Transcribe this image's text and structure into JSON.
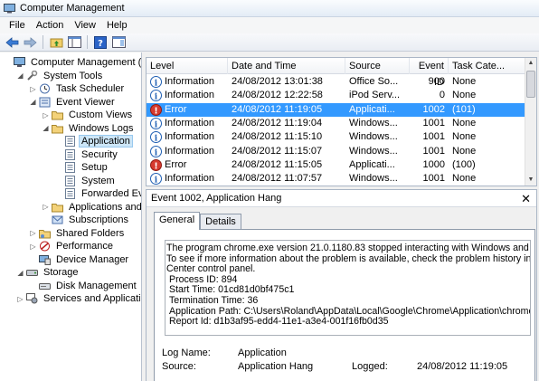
{
  "window": {
    "title": "Computer Management"
  },
  "menu": [
    "File",
    "Action",
    "View",
    "Help"
  ],
  "tree": [
    {
      "label": "Computer Management (Local",
      "indent": 0,
      "arrow": "",
      "icon": "computer-icon"
    },
    {
      "label": "System Tools",
      "indent": 1,
      "arrow": "◢",
      "icon": "tools-icon"
    },
    {
      "label": "Task Scheduler",
      "indent": 2,
      "arrow": "▷",
      "icon": "clock-icon"
    },
    {
      "label": "Event Viewer",
      "indent": 2,
      "arrow": "◢",
      "icon": "event-viewer-icon"
    },
    {
      "label": "Custom Views",
      "indent": 3,
      "arrow": "▷",
      "icon": "folder-icon"
    },
    {
      "label": "Windows Logs",
      "indent": 3,
      "arrow": "◢",
      "icon": "folder-icon"
    },
    {
      "label": "Application",
      "indent": 4,
      "arrow": "",
      "icon": "log-icon",
      "selected": true
    },
    {
      "label": "Security",
      "indent": 4,
      "arrow": "",
      "icon": "log-icon"
    },
    {
      "label": "Setup",
      "indent": 4,
      "arrow": "",
      "icon": "log-icon"
    },
    {
      "label": "System",
      "indent": 4,
      "arrow": "",
      "icon": "log-icon"
    },
    {
      "label": "Forwarded Event",
      "indent": 4,
      "arrow": "",
      "icon": "log-icon"
    },
    {
      "label": "Applications and Se",
      "indent": 3,
      "arrow": "▷",
      "icon": "folder-icon"
    },
    {
      "label": "Subscriptions",
      "indent": 3,
      "arrow": "",
      "icon": "subscription-icon"
    },
    {
      "label": "Shared Folders",
      "indent": 2,
      "arrow": "▷",
      "icon": "shared-folder-icon"
    },
    {
      "label": "Performance",
      "indent": 2,
      "arrow": "▷",
      "icon": "performance-icon"
    },
    {
      "label": "Device Manager",
      "indent": 2,
      "arrow": "",
      "icon": "device-manager-icon"
    },
    {
      "label": "Storage",
      "indent": 1,
      "arrow": "◢",
      "icon": "storage-icon"
    },
    {
      "label": "Disk Management",
      "indent": 2,
      "arrow": "",
      "icon": "disk-icon"
    },
    {
      "label": "Services and Applications",
      "indent": 1,
      "arrow": "▷",
      "icon": "services-icon"
    }
  ],
  "list": {
    "columns": [
      "Level",
      "Date and Time",
      "Source",
      "Event ID",
      "Task Cate..."
    ],
    "rows": [
      {
        "level": "Information",
        "type": "info",
        "date": "24/08/2012 13:01:38",
        "source": "Office So...",
        "id": "900",
        "task": "None"
      },
      {
        "level": "Information",
        "type": "info",
        "date": "24/08/2012 12:22:58",
        "source": "iPod Serv...",
        "id": "0",
        "task": "None"
      },
      {
        "level": "Error",
        "type": "error",
        "date": "24/08/2012 11:19:05",
        "source": "Applicati...",
        "id": "1002",
        "task": "(101)",
        "selected": true
      },
      {
        "level": "Information",
        "type": "info",
        "date": "24/08/2012 11:19:04",
        "source": "Windows...",
        "id": "1001",
        "task": "None"
      },
      {
        "level": "Information",
        "type": "info",
        "date": "24/08/2012 11:15:10",
        "source": "Windows...",
        "id": "1001",
        "task": "None"
      },
      {
        "level": "Information",
        "type": "info",
        "date": "24/08/2012 11:15:07",
        "source": "Windows...",
        "id": "1001",
        "task": "None"
      },
      {
        "level": "Error",
        "type": "error",
        "date": "24/08/2012 11:15:05",
        "source": "Applicati...",
        "id": "1000",
        "task": "(100)"
      },
      {
        "level": "Information",
        "type": "info",
        "date": "24/08/2012 11:07:57",
        "source": "Windows...",
        "id": "1001",
        "task": "None"
      }
    ]
  },
  "detail": {
    "header": "Event 1002, Application Hang",
    "close": "✕",
    "tabs": [
      "General",
      "Details"
    ],
    "description": [
      "The program chrome.exe version 21.0.1180.83 stopped interacting with Windows and was closed",
      "To see if more information about the problem is available, check the problem history in the Act",
      "Center control panel.",
      " Process ID: 894",
      " Start Time: 01cd81d0bf475c1",
      " Termination Time: 36",
      " Application Path: C:\\Users\\Roland\\AppData\\Local\\Google\\Chrome\\Application\\chrome.exe",
      " Report Id: d1b3af95-edd4-11e1-a3e4-001f16fb0d35"
    ],
    "props": {
      "log_name_label": "Log Name:",
      "log_name_value": "Application",
      "source_label": "Source:",
      "source_value": "Application Hang",
      "logged_label": "Logged:",
      "logged_value": "24/08/2012 11:19:05"
    }
  },
  "colors": {
    "selection": "#3399ff",
    "info": "#1f5fb3",
    "error": "#c0241c"
  }
}
